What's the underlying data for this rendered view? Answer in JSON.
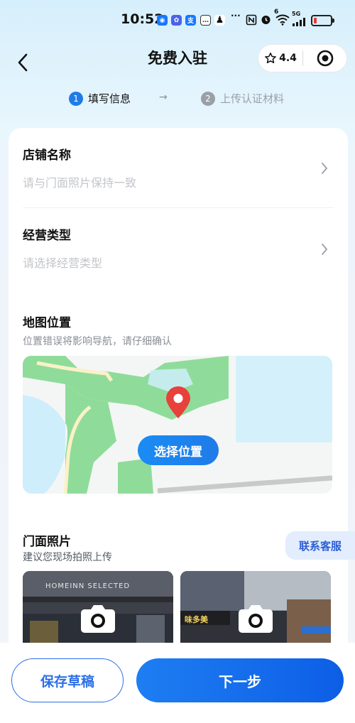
{
  "status_bar": {
    "time": "10:52",
    "app_icons": [
      "alipay-icon",
      "photos-icon",
      "zhi-icon",
      "chat-icon",
      "qq-icon"
    ],
    "more": "···",
    "icons": [
      "nfc-icon",
      "alarm-icon",
      "wifi-icon",
      "signal-icon",
      "battery-icon"
    ],
    "wifi_badge": "6",
    "network": "5G",
    "battery_color": "#e23b3b"
  },
  "header": {
    "title": "免费入驻",
    "rating": "4.4"
  },
  "steps": [
    {
      "num": "1",
      "label": "填写信息",
      "active": true
    },
    {
      "num": "2",
      "label": "上传认证材料",
      "active": false
    }
  ],
  "form": {
    "shop_name": {
      "label": "店铺名称",
      "placeholder": "请与门面照片保持一致"
    },
    "business_type": {
      "label": "经营类型",
      "placeholder": "请选择经营类型"
    },
    "map": {
      "label": "地图位置",
      "hint": "位置错误将影响导航，请仔细确认",
      "button": "选择位置"
    },
    "photos": {
      "label": "门面照片",
      "hint": "建议您现场拍照上传",
      "sign_1": "HOMEINN SELECTED",
      "sign_2": "味多美"
    }
  },
  "customer_service": "联系客服",
  "footer": {
    "save_draft": "保存草稿",
    "next": "下一步"
  },
  "colors": {
    "primary": "#1f7be8",
    "accent_blue": "#2d6fe6",
    "pin_red": "#e8403a",
    "map_green": "#8fdc9a",
    "map_water": "#cfeefb"
  }
}
